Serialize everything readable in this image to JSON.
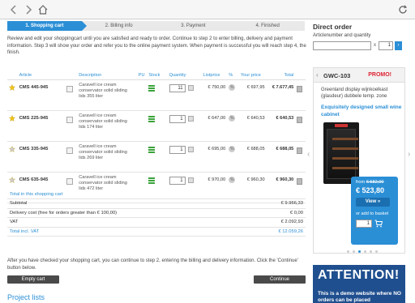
{
  "steps": [
    "1. Shopping cart",
    "2. Billing info",
    "3. Payment",
    "4. Finished"
  ],
  "intro": "Review and edit your shoppingcart until you are satisfied and ready to order. Continue to step 2 to enter billing, delivery and payment information. Step 3 will show your order and refer you to the online payment system. When payment is successful you will reach step 4, the finish.",
  "headers": [
    "Article",
    "Description",
    "PU",
    "Stock",
    "Quantity",
    "Listprice",
    "%",
    "Your price",
    "Total"
  ],
  "rows": [
    {
      "article": "CMS 445-945",
      "desc": [
        "Caravell ice cream",
        "conservator solid sliding",
        "lids 355 liter"
      ],
      "qty": "11",
      "list": "€ 750,00",
      "price": "€ 697,95",
      "total": "€ 7.677,45",
      "star": true
    },
    {
      "article": "CMS 225-945",
      "desc": [
        "Caravell ice cream",
        "conservator solid sliding",
        "lids 174 liter"
      ],
      "qty": "1",
      "list": "€ 647,00",
      "price": "€ 640,53",
      "total": "€ 640,53",
      "star": true
    },
    {
      "article": "CMS 335-945",
      "desc": [
        "Caravell ice cream",
        "conservator solid sliding",
        "lids 269 liter"
      ],
      "qty": "1",
      "list": "€ 695,00",
      "price": "€ 688,05",
      "total": "€ 688,05",
      "star": false
    },
    {
      "article": "CMS 635-945",
      "desc": [
        "Caravell ice cream",
        "conservator solid sliding",
        "lids 472 liter"
      ],
      "qty": "1",
      "list": "€ 970,00",
      "price": "€ 960,30",
      "total": "€ 960,30",
      "star": false
    }
  ],
  "summary": {
    "header": "Total in this shopping cart",
    "subtotal_label": "Subtotal",
    "subtotal": "€ 9.966,33",
    "delivery_label": "Delivery cost (free for orders greater than € 100,00)",
    "delivery": "€ 0,00",
    "vat_label": "VAT",
    "vat": "€ 2.092,93",
    "total_label": "Total incl. VAT",
    "total": "€ 12.059,26"
  },
  "after_text": "After you have checked your shopping cart, you can continue to step 2, entering the billing and delivery information. Click the 'Continue' button below.",
  "buttons": {
    "empty": "Empty cart",
    "continue": "Continue"
  },
  "projects": "Project lists",
  "direct": {
    "title": "Direct order",
    "sub": "Articlenumber and quantity",
    "qty": "1",
    "x": "x"
  },
  "promo": {
    "code": "GWC-103",
    "tag": "PROMO!",
    "line1": "Greenland display wijnkoelkast (glasdeur) dubbele temp. zone",
    "line2": "Exquisitely designed small wine cabinet",
    "from_label": "from",
    "from_price": "€ 582,00",
    "price": "€ 523,80",
    "view": "View »",
    "add": "or add to basket",
    "qty": "1"
  },
  "attention": {
    "title": "ATTENTION!",
    "body": "This is a demo website where NO orders can be placed"
  },
  "colors": {
    "accent": "#2b8fd6",
    "attention": "#1f4f8f"
  }
}
